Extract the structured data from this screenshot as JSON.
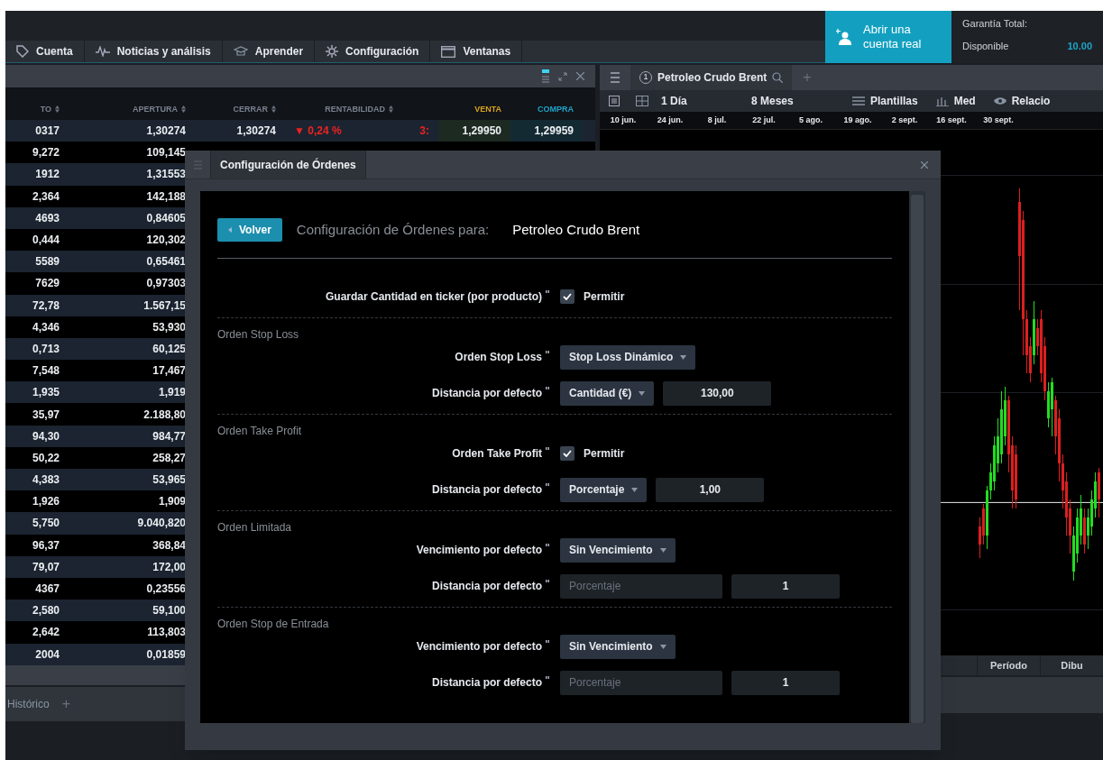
{
  "top_bar": {
    "open_account_button": [
      "Abrir una",
      "cuenta real"
    ],
    "account": {
      "label_total": "Garantía Total:",
      "label_available": "Disponible",
      "available_value": "10.00"
    }
  },
  "nav": [
    "Cuenta",
    "Noticias y análisis",
    "Aprender",
    "Configuración",
    "Ventanas"
  ],
  "quotes_table": {
    "columns": [
      "TO",
      "APERTURA",
      "CERRAR",
      "RENTABILIDAD",
      "",
      "VENTA",
      "COMPRA"
    ],
    "rows": [
      [
        "0317",
        "1,30274",
        "1,30274",
        "▼ 0,24 %",
        "3:",
        "1,29950",
        "1,29959"
      ],
      [
        "9,272",
        "109,145"
      ],
      [
        "1912",
        "1,31553"
      ],
      [
        "2,364",
        "142,188"
      ],
      [
        "4693",
        "0,84605"
      ],
      [
        "0,444",
        "120,302"
      ],
      [
        "5589",
        "0,65461"
      ],
      [
        "7629",
        "0,97303"
      ],
      [
        "72,78",
        "1.567,15"
      ],
      [
        "4,346",
        "53,930"
      ],
      [
        "0,713",
        "60,125"
      ],
      [
        "7,548",
        "17,467"
      ],
      [
        "1,935",
        "1,919"
      ],
      [
        "35,97",
        "2.188,80"
      ],
      [
        "94,30",
        "984,77"
      ],
      [
        "50,22",
        "258,27"
      ],
      [
        "4,383",
        "53,965"
      ],
      [
        "1,926",
        "1,909"
      ],
      [
        "5,750",
        "9.040,820"
      ],
      [
        "96,37",
        "368,84"
      ],
      [
        "79,07",
        "172,00"
      ],
      [
        "4367",
        "0,23556"
      ],
      [
        "2,580",
        "59,100"
      ],
      [
        "2,642",
        "113,803"
      ],
      [
        "2004",
        "0,01859"
      ]
    ]
  },
  "bottom_tabs": [
    "Histórico",
    "+"
  ],
  "chart_panel": {
    "tab_number": "1",
    "tab_title": "Petroleo Crudo Brent",
    "add_tab": "+",
    "interval": "1 Día",
    "range": "8 Meses",
    "tools": [
      "Plantillas",
      "Med",
      "Relacio"
    ],
    "x_labels": [
      "10 jun.",
      "24 jun.",
      "8 jul.",
      "22 jul.",
      "5 ago.",
      "19 ago.",
      "2 sept.",
      "16 sept.",
      "30 sept."
    ],
    "bottom_buttons": [
      "Período",
      "Dibu"
    ]
  },
  "dialog": {
    "title": "Configuración de Órdenes",
    "back_button": "Volver",
    "heading_label": "Configuración de Órdenes para:",
    "heading_product": "Petroleo Crudo Brent",
    "sections": [
      {
        "rows": [
          {
            "kind": "checkbox",
            "label": "Guardar Cantidad en ticker (por producto)",
            "checked": true,
            "option": "Permitir"
          }
        ]
      },
      {
        "title": "Orden Stop Loss",
        "rows": [
          {
            "kind": "select",
            "label": "Orden Stop Loss",
            "value": "Stop Loss Dinámico"
          },
          {
            "kind": "select_input",
            "label": "Distancia por defecto",
            "value": "Cantidad (€)",
            "disabled": false,
            "amount": "130,00"
          }
        ]
      },
      {
        "title": "Orden Take Profit",
        "rows": [
          {
            "kind": "checkbox",
            "label": "Orden Take Profit",
            "checked": true,
            "option": "Permitir"
          },
          {
            "kind": "select_input",
            "label": "Distancia por defecto",
            "value": "Porcentaje",
            "disabled": false,
            "amount": "1,00"
          }
        ]
      },
      {
        "title": "Orden Limitada",
        "rows": [
          {
            "kind": "select",
            "label": "Vencimiento por defecto",
            "value": "Sin Vencimiento"
          },
          {
            "kind": "select_input",
            "label": "Distancia por defecto",
            "value": "Porcentaje",
            "disabled": true,
            "amount": "1"
          }
        ]
      },
      {
        "title": "Orden Stop de Entrada",
        "rows": [
          {
            "kind": "select",
            "label": "Vencimiento por defecto",
            "value": "Sin Vencimiento"
          },
          {
            "kind": "select_input",
            "label": "Distancia por defecto",
            "value": "Porcentaje",
            "disabled": true,
            "amount": "1"
          }
        ]
      }
    ]
  }
}
